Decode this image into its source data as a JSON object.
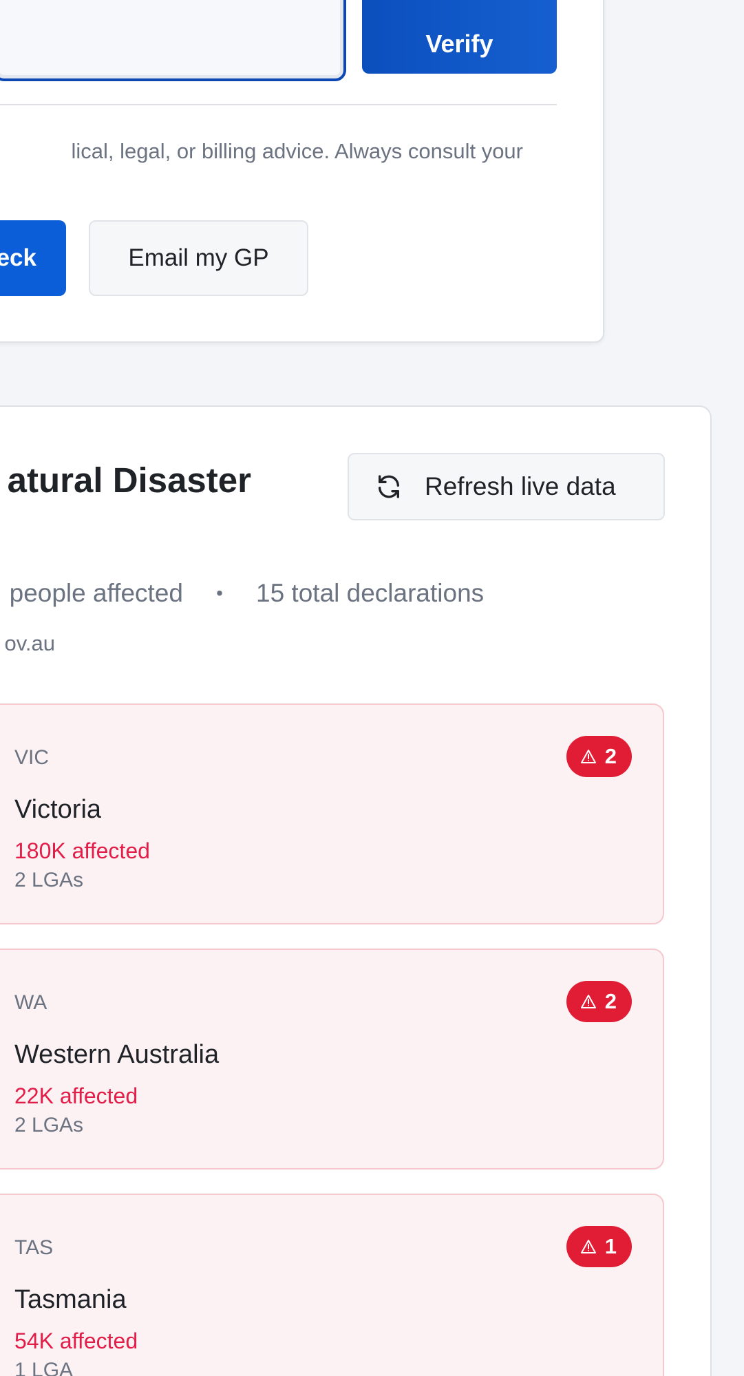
{
  "verify_section": {
    "verify_label": "Verify",
    "disclaimer": "lical, legal, or billing advice. Always consult your",
    "recheck_label": "eck",
    "email_label": "Email my GP"
  },
  "disaster_section": {
    "title": "atural Disaster",
    "refresh_label": "Refresh live data",
    "people_affected": "people affected",
    "total_declarations": "15 total declarations",
    "source": "ov.au"
  },
  "states": [
    {
      "code": "VIC",
      "name": "Victoria",
      "affected": "180K affected",
      "lgas": "2 LGAs",
      "alerts": "2"
    },
    {
      "code": "WA",
      "name": "Western Australia",
      "affected": "22K affected",
      "lgas": "2 LGAs",
      "alerts": "2"
    },
    {
      "code": "TAS",
      "name": "Tasmania",
      "affected": "54K affected",
      "lgas": "1 LGA",
      "alerts": "1"
    }
  ],
  "colors": {
    "primary": "#0b5ed7",
    "alert": "#e11d36",
    "affected_text": "#e11d48",
    "state_card_bg": "#fdf2f3"
  },
  "icons": {
    "refresh": "refresh-icon",
    "alert": "warning-triangle-icon"
  }
}
